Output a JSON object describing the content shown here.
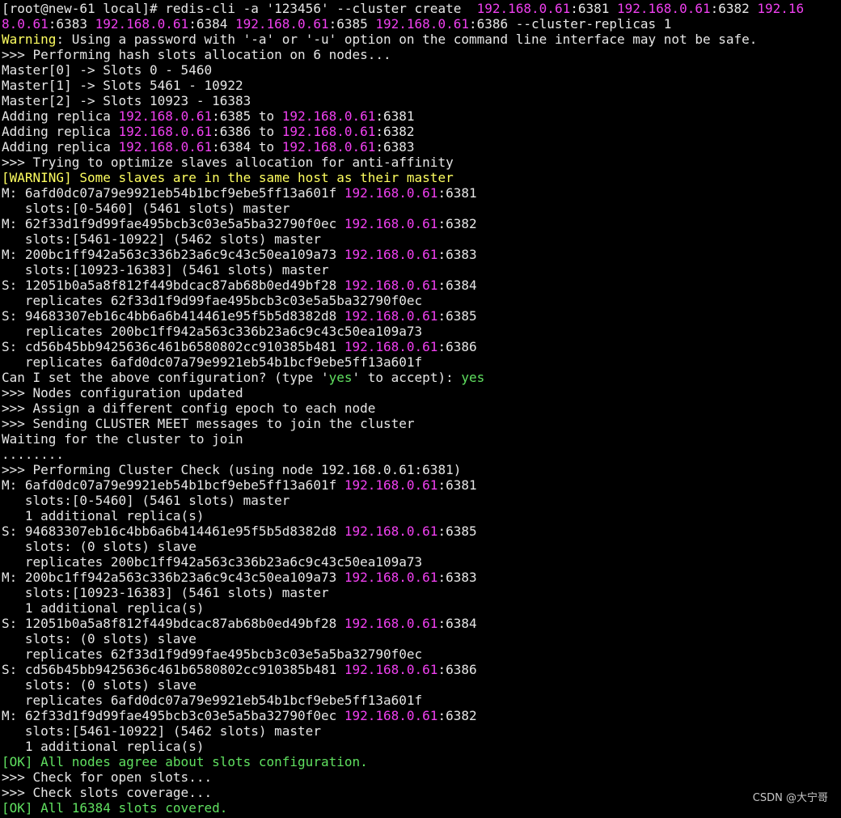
{
  "colors": {
    "background": "#000000",
    "default_text": "#e6e6e6",
    "ip_address": "#f040f0",
    "warning": "#ffff60",
    "ok": "#60e060"
  },
  "terminal": {
    "lines": [
      [
        {
          "t": "[root@new-61 local]# redis-cli -a '123456' --cluster create  ",
          "c": "default"
        },
        {
          "t": "192.168.0.61",
          "c": "ip"
        },
        {
          "t": ":6381 ",
          "c": "default"
        },
        {
          "t": "192.168.0.61",
          "c": "ip"
        },
        {
          "t": ":6382 ",
          "c": "default"
        },
        {
          "t": "192.16",
          "c": "ip"
        }
      ],
      [
        {
          "t": "8.0.61",
          "c": "ip"
        },
        {
          "t": ":6383 ",
          "c": "default"
        },
        {
          "t": "192.168.0.61",
          "c": "ip"
        },
        {
          "t": ":6384 ",
          "c": "default"
        },
        {
          "t": "192.168.0.61",
          "c": "ip"
        },
        {
          "t": ":6385 ",
          "c": "default"
        },
        {
          "t": "192.168.0.61",
          "c": "ip"
        },
        {
          "t": ":6386 --cluster-replicas 1",
          "c": "default"
        }
      ],
      [
        {
          "t": "Warning",
          "c": "warn"
        },
        {
          "t": ": Using a password with '-a' or '-u' option on the command line interface may not be safe.",
          "c": "default"
        }
      ],
      [
        {
          "t": ">>> Performing hash slots allocation on 6 nodes...",
          "c": "default"
        }
      ],
      [
        {
          "t": "Master[0] -> Slots 0 - 5460",
          "c": "default"
        }
      ],
      [
        {
          "t": "Master[1] -> Slots 5461 - 10922",
          "c": "default"
        }
      ],
      [
        {
          "t": "Master[2] -> Slots 10923 - 16383",
          "c": "default"
        }
      ],
      [
        {
          "t": "Adding replica ",
          "c": "default"
        },
        {
          "t": "192.168.0.61",
          "c": "ip"
        },
        {
          "t": ":6385 to ",
          "c": "default"
        },
        {
          "t": "192.168.0.61",
          "c": "ip"
        },
        {
          "t": ":6381",
          "c": "default"
        }
      ],
      [
        {
          "t": "Adding replica ",
          "c": "default"
        },
        {
          "t": "192.168.0.61",
          "c": "ip"
        },
        {
          "t": ":6386 to ",
          "c": "default"
        },
        {
          "t": "192.168.0.61",
          "c": "ip"
        },
        {
          "t": ":6382",
          "c": "default"
        }
      ],
      [
        {
          "t": "Adding replica ",
          "c": "default"
        },
        {
          "t": "192.168.0.61",
          "c": "ip"
        },
        {
          "t": ":6384 to ",
          "c": "default"
        },
        {
          "t": "192.168.0.61",
          "c": "ip"
        },
        {
          "t": ":6383",
          "c": "default"
        }
      ],
      [
        {
          "t": ">>> Trying to optimize slaves allocation for anti-affinity",
          "c": "default"
        }
      ],
      [
        {
          "t": "[WARNING] Some slaves are in the same host as their master",
          "c": "warn"
        }
      ],
      [
        {
          "t": "M: 6afd0dc07a79e9921eb54b1bcf9ebe5ff13a601f ",
          "c": "default"
        },
        {
          "t": "192.168.0.61",
          "c": "ip"
        },
        {
          "t": ":6381",
          "c": "default"
        }
      ],
      [
        {
          "t": "   slots:[0-5460] (5461 slots) master",
          "c": "default"
        }
      ],
      [
        {
          "t": "M: 62f33d1f9d99fae495bcb3c03e5a5ba32790f0ec ",
          "c": "default"
        },
        {
          "t": "192.168.0.61",
          "c": "ip"
        },
        {
          "t": ":6382",
          "c": "default"
        }
      ],
      [
        {
          "t": "   slots:[5461-10922] (5462 slots) master",
          "c": "default"
        }
      ],
      [
        {
          "t": "M: 200bc1ff942a563c336b23a6c9c43c50ea109a73 ",
          "c": "default"
        },
        {
          "t": "192.168.0.61",
          "c": "ip"
        },
        {
          "t": ":6383",
          "c": "default"
        }
      ],
      [
        {
          "t": "   slots:[10923-16383] (5461 slots) master",
          "c": "default"
        }
      ],
      [
        {
          "t": "S: 12051b0a5a8f812f449bdcac87ab68b0ed49bf28 ",
          "c": "default"
        },
        {
          "t": "192.168.0.61",
          "c": "ip"
        },
        {
          "t": ":6384",
          "c": "default"
        }
      ],
      [
        {
          "t": "   replicates 62f33d1f9d99fae495bcb3c03e5a5ba32790f0ec",
          "c": "default"
        }
      ],
      [
        {
          "t": "S: 94683307eb16c4bb6a6b414461e95f5b5d8382d8 ",
          "c": "default"
        },
        {
          "t": "192.168.0.61",
          "c": "ip"
        },
        {
          "t": ":6385",
          "c": "default"
        }
      ],
      [
        {
          "t": "   replicates 200bc1ff942a563c336b23a6c9c43c50ea109a73",
          "c": "default"
        }
      ],
      [
        {
          "t": "S: cd56b45bb9425636c461b6580802cc910385b481 ",
          "c": "default"
        },
        {
          "t": "192.168.0.61",
          "c": "ip"
        },
        {
          "t": ":6386",
          "c": "default"
        }
      ],
      [
        {
          "t": "   replicates 6afd0dc07a79e9921eb54b1bcf9ebe5ff13a601f",
          "c": "default"
        }
      ],
      [
        {
          "t": "Can I set the above configuration? (type '",
          "c": "default"
        },
        {
          "t": "yes",
          "c": "ok"
        },
        {
          "t": "' to accept): ",
          "c": "default"
        },
        {
          "t": "yes",
          "c": "ok"
        }
      ],
      [
        {
          "t": ">>> Nodes configuration updated",
          "c": "default"
        }
      ],
      [
        {
          "t": ">>> Assign a different config epoch to each node",
          "c": "default"
        }
      ],
      [
        {
          "t": ">>> Sending CLUSTER MEET messages to join the cluster",
          "c": "default"
        }
      ],
      [
        {
          "t": "Waiting for the cluster to join",
          "c": "default"
        }
      ],
      [
        {
          "t": "........",
          "c": "default"
        }
      ],
      [
        {
          "t": ">>> Performing Cluster Check (using node 192.168.0.61:6381)",
          "c": "default"
        }
      ],
      [
        {
          "t": "M: 6afd0dc07a79e9921eb54b1bcf9ebe5ff13a601f ",
          "c": "default"
        },
        {
          "t": "192.168.0.61",
          "c": "ip"
        },
        {
          "t": ":6381",
          "c": "default"
        }
      ],
      [
        {
          "t": "   slots:[0-5460] (5461 slots) master",
          "c": "default"
        }
      ],
      [
        {
          "t": "   1 additional replica(s)",
          "c": "default"
        }
      ],
      [
        {
          "t": "S: 94683307eb16c4bb6a6b414461e95f5b5d8382d8 ",
          "c": "default"
        },
        {
          "t": "192.168.0.61",
          "c": "ip"
        },
        {
          "t": ":6385",
          "c": "default"
        }
      ],
      [
        {
          "t": "   slots: (0 slots) slave",
          "c": "default"
        }
      ],
      [
        {
          "t": "   replicates 200bc1ff942a563c336b23a6c9c43c50ea109a73",
          "c": "default"
        }
      ],
      [
        {
          "t": "M: 200bc1ff942a563c336b23a6c9c43c50ea109a73 ",
          "c": "default"
        },
        {
          "t": "192.168.0.61",
          "c": "ip"
        },
        {
          "t": ":6383",
          "c": "default"
        }
      ],
      [
        {
          "t": "   slots:[10923-16383] (5461 slots) master",
          "c": "default"
        }
      ],
      [
        {
          "t": "   1 additional replica(s)",
          "c": "default"
        }
      ],
      [
        {
          "t": "S: 12051b0a5a8f812f449bdcac87ab68b0ed49bf28 ",
          "c": "default"
        },
        {
          "t": "192.168.0.61",
          "c": "ip"
        },
        {
          "t": ":6384",
          "c": "default"
        }
      ],
      [
        {
          "t": "   slots: (0 slots) slave",
          "c": "default"
        }
      ],
      [
        {
          "t": "   replicates 62f33d1f9d99fae495bcb3c03e5a5ba32790f0ec",
          "c": "default"
        }
      ],
      [
        {
          "t": "S: cd56b45bb9425636c461b6580802cc910385b481 ",
          "c": "default"
        },
        {
          "t": "192.168.0.61",
          "c": "ip"
        },
        {
          "t": ":6386",
          "c": "default"
        }
      ],
      [
        {
          "t": "   slots: (0 slots) slave",
          "c": "default"
        }
      ],
      [
        {
          "t": "   replicates 6afd0dc07a79e9921eb54b1bcf9ebe5ff13a601f",
          "c": "default"
        }
      ],
      [
        {
          "t": "M: 62f33d1f9d99fae495bcb3c03e5a5ba32790f0ec ",
          "c": "default"
        },
        {
          "t": "192.168.0.61",
          "c": "ip"
        },
        {
          "t": ":6382",
          "c": "default"
        }
      ],
      [
        {
          "t": "   slots:[5461-10922] (5462 slots) master",
          "c": "default"
        }
      ],
      [
        {
          "t": "   1 additional replica(s)",
          "c": "default"
        }
      ],
      [
        {
          "t": "[OK] All nodes agree about slots configuration.",
          "c": "ok"
        }
      ],
      [
        {
          "t": ">>> Check for open slots...",
          "c": "default"
        }
      ],
      [
        {
          "t": ">>> Check slots coverage...",
          "c": "default"
        }
      ],
      [
        {
          "t": "[OK] All 16384 slots covered.",
          "c": "ok"
        }
      ]
    ]
  },
  "watermark": {
    "text": "CSDN @大宁哥"
  }
}
